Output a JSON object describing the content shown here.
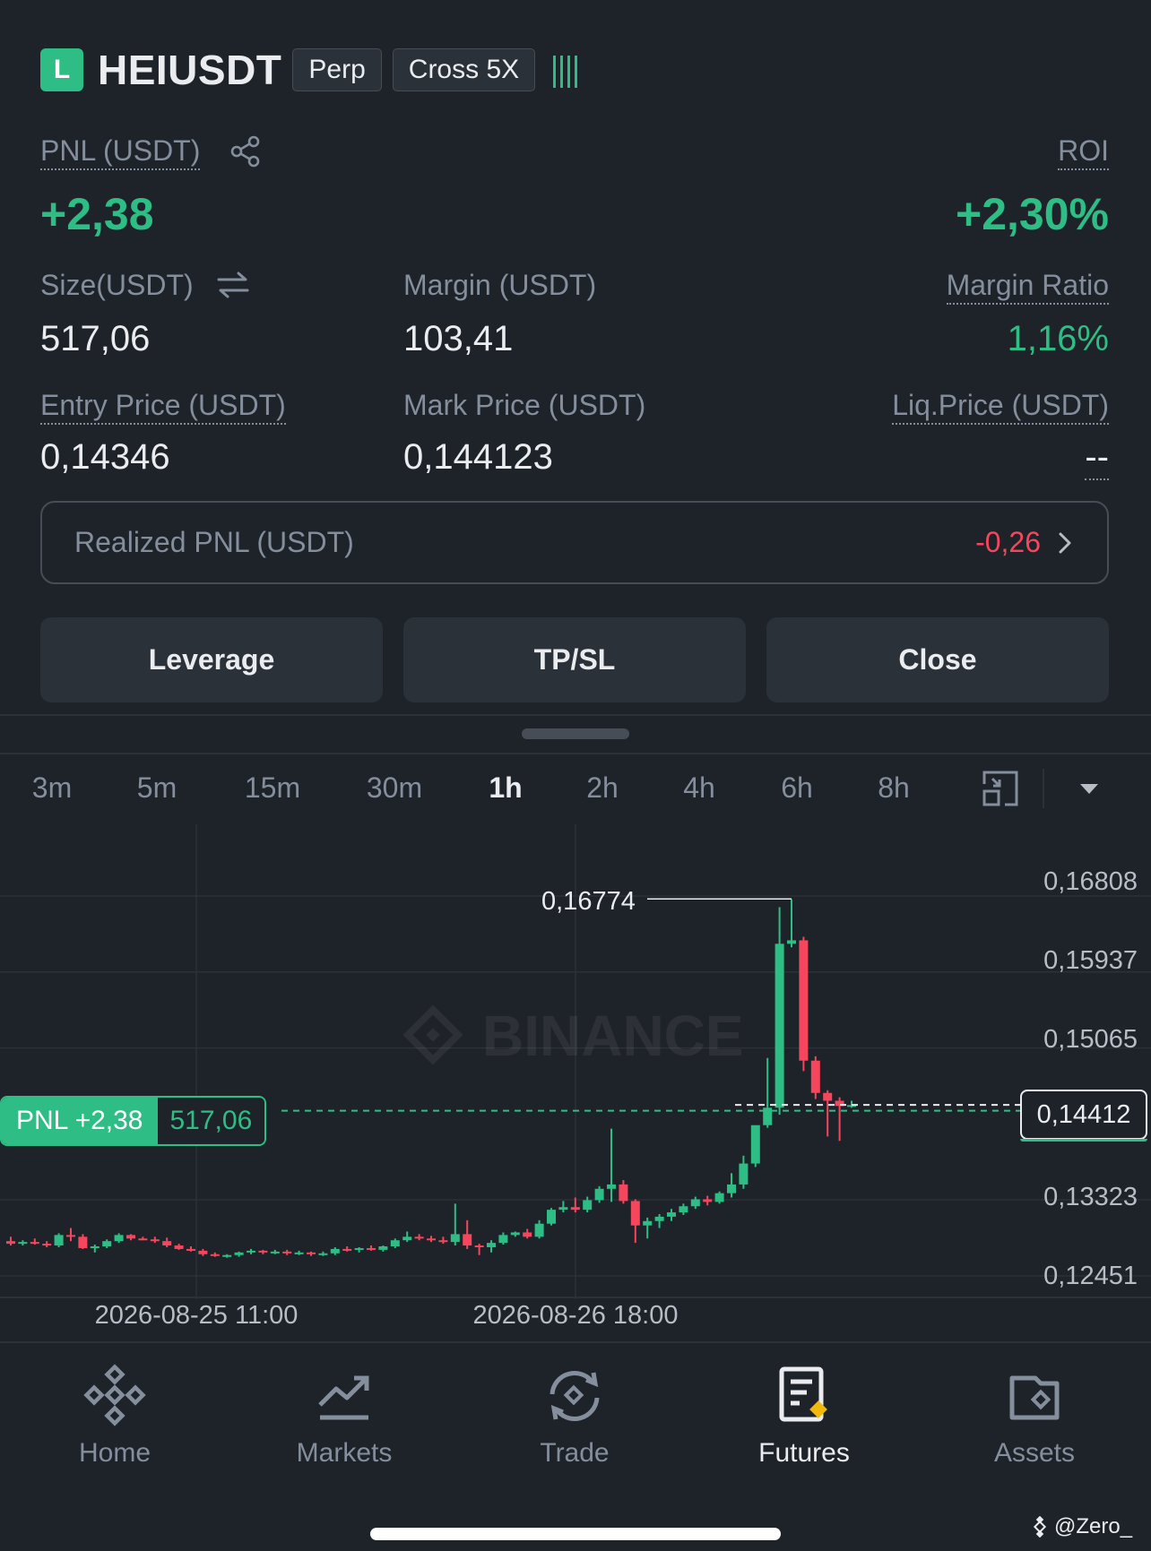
{
  "header": {
    "side": "L",
    "symbol": "HEIUSDT",
    "contract_type": "Perp",
    "margin_mode": "Cross 5X",
    "signal_indicator": "!!!!"
  },
  "position": {
    "pnl_label": "PNL (USDT)",
    "pnl_value": "+2,38",
    "roi_label": "ROI",
    "roi_value": "+2,30%",
    "size_label": "Size(USDT)",
    "size_value": "517,06",
    "margin_label": "Margin (USDT)",
    "margin_value": "103,41",
    "margin_ratio_label": "Margin Ratio",
    "margin_ratio_value": "1,16%",
    "entry_price_label": "Entry Price (USDT)",
    "entry_price_value": "0,14346",
    "mark_price_label": "Mark Price (USDT)",
    "mark_price_value": "0,144123",
    "liq_price_label": "Liq.Price (USDT)",
    "liq_price_value": "--",
    "realized_pnl_label": "Realized PNL (USDT)",
    "realized_pnl_value": "-0,26"
  },
  "actions": {
    "leverage": "Leverage",
    "tpsl": "TP/SL",
    "close": "Close"
  },
  "timeframes": [
    "3m",
    "5m",
    "15m",
    "30m",
    "1h",
    "2h",
    "4h",
    "6h",
    "8h"
  ],
  "active_timeframe": "1h",
  "chart": {
    "watermark": "BINANCE",
    "high_label": "0,16774",
    "current_price_label": "0,14412",
    "pnl_tag_label": "PNL +2,38",
    "pnl_tag_value": "517,06",
    "y_ticks": [
      "0,16808",
      "0,15937",
      "0,15065",
      "0,14412",
      "0,13323",
      "0,12451"
    ],
    "x_ticks": [
      "2026-08-25 11:00",
      "2026-08-26 18:00"
    ]
  },
  "chart_data": {
    "type": "candlestick",
    "interval": "1h",
    "ylim": [
      0.12451,
      0.16808
    ],
    "y_ticks": [
      0.16808,
      0.15937,
      0.15065,
      0.13323,
      0.12451
    ],
    "x_ticks": [
      "2026-08-25 11:00",
      "2026-08-26 18:00"
    ],
    "current_price": 0.14412,
    "entry_price": 0.14346,
    "annotated_high": 0.16774,
    "colors": {
      "up": "#2ebd85",
      "down": "#f6465d"
    },
    "candles": [
      [
        0.1285,
        0.129,
        0.128,
        0.1282
      ],
      [
        0.1282,
        0.1286,
        0.128,
        0.1284
      ],
      [
        0.1284,
        0.1288,
        0.1281,
        0.1282
      ],
      [
        0.1282,
        0.1285,
        0.1278,
        0.128
      ],
      [
        0.128,
        0.1294,
        0.1278,
        0.1292
      ],
      [
        0.1292,
        0.13,
        0.1285,
        0.129
      ],
      [
        0.129,
        0.1293,
        0.1276,
        0.1277
      ],
      [
        0.1277,
        0.1281,
        0.1272,
        0.1279
      ],
      [
        0.1279,
        0.1287,
        0.1277,
        0.1285
      ],
      [
        0.1285,
        0.1294,
        0.1283,
        0.1292
      ],
      [
        0.1292,
        0.1293,
        0.1286,
        0.1288
      ],
      [
        0.1288,
        0.129,
        0.1286,
        0.1287
      ],
      [
        0.1287,
        0.129,
        0.1283,
        0.1285
      ],
      [
        0.1285,
        0.1289,
        0.1278,
        0.128
      ],
      [
        0.128,
        0.1282,
        0.1275,
        0.1276
      ],
      [
        0.1276,
        0.1279,
        0.1273,
        0.1274
      ],
      [
        0.1274,
        0.1276,
        0.1268,
        0.127
      ],
      [
        0.127,
        0.1272,
        0.1267,
        0.1268
      ],
      [
        0.1268,
        0.127,
        0.1266,
        0.1269
      ],
      [
        0.1269,
        0.1273,
        0.1267,
        0.1272
      ],
      [
        0.1272,
        0.1276,
        0.127,
        0.1274
      ],
      [
        0.1274,
        0.1275,
        0.127,
        0.1272
      ],
      [
        0.1272,
        0.1275,
        0.127,
        0.1273
      ],
      [
        0.1273,
        0.1275,
        0.1269,
        0.1271
      ],
      [
        0.1271,
        0.1274,
        0.1269,
        0.1272
      ],
      [
        0.1272,
        0.1273,
        0.1268,
        0.127
      ],
      [
        0.127,
        0.1273,
        0.1268,
        0.1271
      ],
      [
        0.1271,
        0.1278,
        0.1269,
        0.1276
      ],
      [
        0.1276,
        0.1279,
        0.1273,
        0.1275
      ],
      [
        0.1275,
        0.1278,
        0.1272,
        0.1277
      ],
      [
        0.1277,
        0.128,
        0.1274,
        0.1275
      ],
      [
        0.1275,
        0.128,
        0.1273,
        0.1279
      ],
      [
        0.1279,
        0.1288,
        0.1277,
        0.1286
      ],
      [
        0.1286,
        0.1296,
        0.1284,
        0.129
      ],
      [
        0.129,
        0.1293,
        0.1286,
        0.1288
      ],
      [
        0.1288,
        0.1291,
        0.1284,
        0.1286
      ],
      [
        0.1286,
        0.129,
        0.1282,
        0.1284
      ],
      [
        0.1284,
        0.1328,
        0.128,
        0.1293
      ],
      [
        0.1293,
        0.1309,
        0.1276,
        0.128
      ],
      [
        0.128,
        0.1282,
        0.1269,
        0.1278
      ],
      [
        0.1278,
        0.1286,
        0.1272,
        0.1283
      ],
      [
        0.1283,
        0.1295,
        0.1281,
        0.1292
      ],
      [
        0.1292,
        0.1296,
        0.129,
        0.1295
      ],
      [
        0.1295,
        0.1299,
        0.1288,
        0.129
      ],
      [
        0.129,
        0.1309,
        0.1288,
        0.1305
      ],
      [
        0.1305,
        0.1323,
        0.1303,
        0.1321
      ],
      [
        0.1321,
        0.1331,
        0.1318,
        0.1324
      ],
      [
        0.1324,
        0.1335,
        0.1318,
        0.1321
      ],
      [
        0.1321,
        0.1336,
        0.1318,
        0.1332
      ],
      [
        0.1332,
        0.1348,
        0.1329,
        0.1345
      ],
      [
        0.1345,
        0.1414,
        0.133,
        0.135
      ],
      [
        0.135,
        0.1355,
        0.1328,
        0.1331
      ],
      [
        0.1331,
        0.1333,
        0.1283,
        0.1303
      ],
      [
        0.1303,
        0.1312,
        0.1288,
        0.1308
      ],
      [
        0.1308,
        0.1316,
        0.13,
        0.1313
      ],
      [
        0.1313,
        0.1322,
        0.1308,
        0.1318
      ],
      [
        0.1318,
        0.1328,
        0.1315,
        0.1325
      ],
      [
        0.1325,
        0.1336,
        0.1322,
        0.1333
      ],
      [
        0.1333,
        0.1337,
        0.1326,
        0.133
      ],
      [
        0.133,
        0.1342,
        0.1328,
        0.134
      ],
      [
        0.134,
        0.1363,
        0.1335,
        0.135
      ],
      [
        0.135,
        0.1383,
        0.1345,
        0.1374
      ],
      [
        0.1374,
        0.1403,
        0.137,
        0.1418
      ],
      [
        0.1418,
        0.1495,
        0.1415,
        0.1438
      ],
      [
        0.1438,
        0.1668,
        0.143,
        0.1626
      ],
      [
        0.1626,
        0.1677,
        0.1622,
        0.163
      ],
      [
        0.163,
        0.1634,
        0.148,
        0.1492
      ],
      [
        0.1492,
        0.1497,
        0.1448,
        0.1455
      ],
      [
        0.1455,
        0.1458,
        0.1405,
        0.1446
      ],
      [
        0.1446,
        0.145,
        0.14,
        0.144
      ],
      [
        0.144,
        0.1446,
        0.1438,
        0.1441
      ]
    ]
  },
  "nav": {
    "home": "Home",
    "markets": "Markets",
    "trade": "Trade",
    "futures": "Futures",
    "assets": "Assets"
  },
  "footer": {
    "credit": "@Zero_"
  }
}
